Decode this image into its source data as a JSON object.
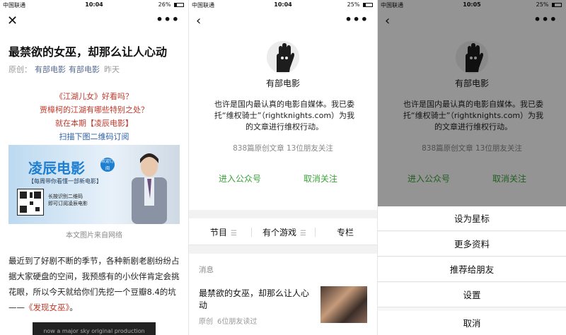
{
  "status": {
    "carrier": "中国联通",
    "battery_icon": "battery-icon",
    "panels": [
      {
        "time": "10:04",
        "battery": "26%",
        "battery_level": 0.26
      },
      {
        "time": "10:04",
        "battery": "25%",
        "battery_level": 0.25
      },
      {
        "time": "10:05",
        "battery": "25%",
        "battery_level": 0.25
      }
    ]
  },
  "article": {
    "title": "最禁欲的女巫，却那么让人心动",
    "original_label": "原创：",
    "author": "有部电影",
    "account": "有部电影",
    "date": "昨天",
    "promo_lines": [
      "《江湖儿女》好看吗？",
      "贾樟柯的江湖有哪些特别之处？",
      "就在本期【凌辰电影】",
      "扫描下图二维码订阅"
    ],
    "banner": {
      "title": "凌辰电影",
      "badge": "欢迎订阅",
      "subtitle": "【每周带你看懂一部新电影】",
      "hint_lines": [
        "长按识别二维码",
        "即可订阅凌辰电影"
      ]
    },
    "image_caption": "本文图片来自网络",
    "body_prefix": "最近到了好剧不断的季节，各种新剧老剧纷纷占据大家硬盘的空间，我预感有的小伙伴肯定会挑花眼，所以今天就给你们先挖一个豆瓣8.4的坑——",
    "body_movie": "《发现女巫》",
    "body_suffix": "。",
    "video_strip_text": "now a major sky original production"
  },
  "profile": {
    "name": "有部电影",
    "description": "也许是国内最认真的电影自媒体。我已委托“维权骑士”（rightknights.com）为我的文章进行维权行动。",
    "stats": "838篇原创文章  13位朋友关注",
    "enter_label": "进入公众号",
    "unfollow_label": "取消关注",
    "menu": [
      {
        "label": "节目",
        "has_submenu": true
      },
      {
        "label": "有个游戏",
        "has_submenu": true
      },
      {
        "label": "专栏",
        "has_submenu": false
      }
    ],
    "messages_label": "消息",
    "latest_message": {
      "title": "最禁欲的女巫，却那么让人心动",
      "tag": "原创",
      "reads": "6位朋友读过"
    }
  },
  "action_sheet": {
    "options": [
      "设为星标",
      "更多资料",
      "推荐给朋友",
      "设置"
    ],
    "cancel": "取消"
  },
  "icons": {
    "close": "close-icon",
    "back": "back-chevron-icon",
    "more": "more-dots-icon",
    "menu": "hamburger-icon"
  },
  "colors": {
    "link": "#576b95",
    "accent_green": "#3aa33a",
    "promo_red": "#c0392b",
    "promo_blue": "#2b5ea8"
  }
}
